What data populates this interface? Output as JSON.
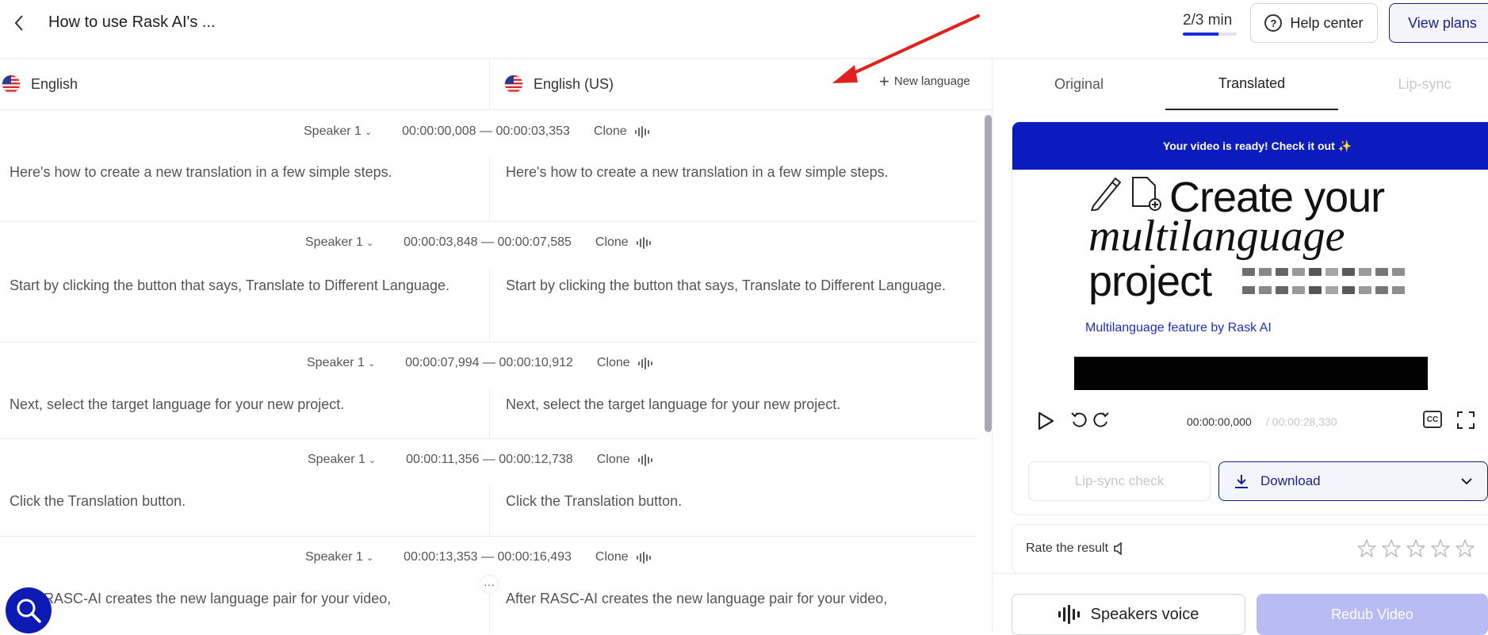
{
  "header": {
    "title": "How to use Rask AI's ...",
    "minutes": "2/3 min",
    "minutes_progress": 0.667,
    "help_label": "Help center",
    "plans_label": "View plans"
  },
  "languages": {
    "source": "English",
    "target": "English (US)",
    "new_language": "New language"
  },
  "segments": [
    {
      "speaker": "Speaker 1",
      "time": "00:00:00,008 — 00:00:03,353",
      "clone": "Clone",
      "original": "Here's how to create a new translation in a few simple steps.",
      "translated": "Here's how to create a new translation in a few simple steps."
    },
    {
      "speaker": "Speaker 1",
      "time": "00:00:03,848 — 00:00:07,585",
      "clone": "Clone",
      "original": "Start by clicking the button that says, Translate to Different Language.",
      "translated": "Start by clicking the button that says, Translate to Different Language."
    },
    {
      "speaker": "Speaker 1",
      "time": "00:00:07,994 — 00:00:10,912",
      "clone": "Clone",
      "original": "Next, select the target language for your new project.",
      "translated": "Next, select the target language for your new project."
    },
    {
      "speaker": "Speaker 1",
      "time": "00:00:11,356 — 00:00:12,738",
      "clone": "Clone",
      "original": "Click the Translation button.",
      "translated": "Click the Translation button."
    },
    {
      "speaker": "Speaker 1",
      "time": "00:00:13,353 — 00:00:16,493",
      "clone": "Clone",
      "original": "After RASC-AI creates the new language pair for your video,",
      "translated": "After RASC-AI creates the new language pair for your video,"
    }
  ],
  "tabs": {
    "original": "Original",
    "translated": "Translated",
    "lipsync": "Lip-sync"
  },
  "video": {
    "banner": "Your video is ready! Check it out ✨",
    "frame_line1": "Create your",
    "frame_line2": "multilanguage",
    "frame_line3": "project",
    "frame_sub": "Multilanguage feature by Rask AI",
    "time_current": "00:00:00,000",
    "time_total": "/ 00:00:28,330",
    "cc": "CC"
  },
  "actions": {
    "lipsync_check": "Lip-sync check",
    "download": "Download",
    "rate": "Rate the result",
    "speakers_voice": "Speakers voice",
    "redub": "Redub Video"
  },
  "colors": {
    "accent": "#0b1bbd",
    "redub_disabled": "#b9bcf3",
    "annotation_arrow": "#e0211c"
  }
}
